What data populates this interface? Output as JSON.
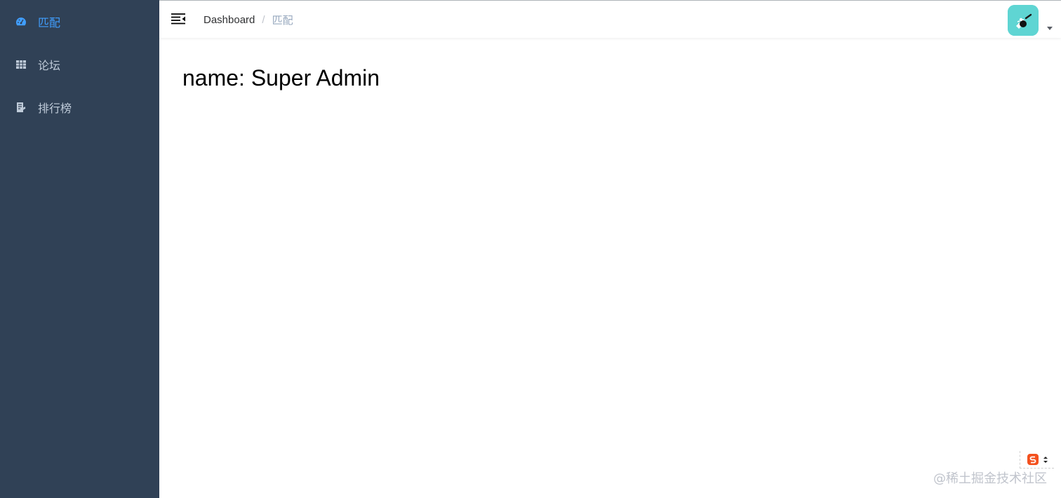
{
  "sidebar": {
    "items": [
      {
        "label": "匹配",
        "icon": "dashboard-icon",
        "active": true
      },
      {
        "label": "论坛",
        "icon": "table-grid-icon",
        "active": false
      },
      {
        "label": "排行榜",
        "icon": "form-icon",
        "active": false
      }
    ]
  },
  "navbar": {
    "breadcrumb": {
      "root": "Dashboard",
      "separator": "/",
      "current": "匹配"
    },
    "avatar_color": "#5fd5d3"
  },
  "main": {
    "heading": "name: Super Admin"
  },
  "watermark": "@稀土掘金技术社区",
  "colors": {
    "sidebar_bg": "#304156",
    "menu_text": "#bfcbd9",
    "menu_active": "#409eff",
    "breadcrumb_current": "#97a8be"
  }
}
